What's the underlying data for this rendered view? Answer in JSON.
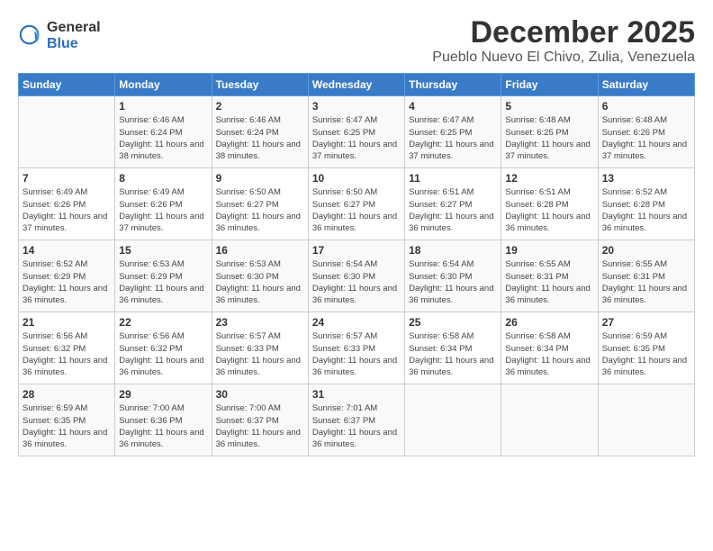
{
  "logo": {
    "general": "General",
    "blue": "Blue"
  },
  "title": "December 2025",
  "subtitle": "Pueblo Nuevo El Chivo, Zulia, Venezuela",
  "days_of_week": [
    "Sunday",
    "Monday",
    "Tuesday",
    "Wednesday",
    "Thursday",
    "Friday",
    "Saturday"
  ],
  "weeks": [
    [
      {
        "day": "",
        "sunrise": "",
        "sunset": "",
        "daylight": ""
      },
      {
        "day": "1",
        "sunrise": "Sunrise: 6:46 AM",
        "sunset": "Sunset: 6:24 PM",
        "daylight": "Daylight: 11 hours and 38 minutes."
      },
      {
        "day": "2",
        "sunrise": "Sunrise: 6:46 AM",
        "sunset": "Sunset: 6:24 PM",
        "daylight": "Daylight: 11 hours and 38 minutes."
      },
      {
        "day": "3",
        "sunrise": "Sunrise: 6:47 AM",
        "sunset": "Sunset: 6:25 PM",
        "daylight": "Daylight: 11 hours and 37 minutes."
      },
      {
        "day": "4",
        "sunrise": "Sunrise: 6:47 AM",
        "sunset": "Sunset: 6:25 PM",
        "daylight": "Daylight: 11 hours and 37 minutes."
      },
      {
        "day": "5",
        "sunrise": "Sunrise: 6:48 AM",
        "sunset": "Sunset: 6:25 PM",
        "daylight": "Daylight: 11 hours and 37 minutes."
      },
      {
        "day": "6",
        "sunrise": "Sunrise: 6:48 AM",
        "sunset": "Sunset: 6:26 PM",
        "daylight": "Daylight: 11 hours and 37 minutes."
      }
    ],
    [
      {
        "day": "7",
        "sunrise": "Sunrise: 6:49 AM",
        "sunset": "Sunset: 6:26 PM",
        "daylight": "Daylight: 11 hours and 37 minutes."
      },
      {
        "day": "8",
        "sunrise": "Sunrise: 6:49 AM",
        "sunset": "Sunset: 6:26 PM",
        "daylight": "Daylight: 11 hours and 37 minutes."
      },
      {
        "day": "9",
        "sunrise": "Sunrise: 6:50 AM",
        "sunset": "Sunset: 6:27 PM",
        "daylight": "Daylight: 11 hours and 36 minutes."
      },
      {
        "day": "10",
        "sunrise": "Sunrise: 6:50 AM",
        "sunset": "Sunset: 6:27 PM",
        "daylight": "Daylight: 11 hours and 36 minutes."
      },
      {
        "day": "11",
        "sunrise": "Sunrise: 6:51 AM",
        "sunset": "Sunset: 6:27 PM",
        "daylight": "Daylight: 11 hours and 36 minutes."
      },
      {
        "day": "12",
        "sunrise": "Sunrise: 6:51 AM",
        "sunset": "Sunset: 6:28 PM",
        "daylight": "Daylight: 11 hours and 36 minutes."
      },
      {
        "day": "13",
        "sunrise": "Sunrise: 6:52 AM",
        "sunset": "Sunset: 6:28 PM",
        "daylight": "Daylight: 11 hours and 36 minutes."
      }
    ],
    [
      {
        "day": "14",
        "sunrise": "Sunrise: 6:52 AM",
        "sunset": "Sunset: 6:29 PM",
        "daylight": "Daylight: 11 hours and 36 minutes."
      },
      {
        "day": "15",
        "sunrise": "Sunrise: 6:53 AM",
        "sunset": "Sunset: 6:29 PM",
        "daylight": "Daylight: 11 hours and 36 minutes."
      },
      {
        "day": "16",
        "sunrise": "Sunrise: 6:53 AM",
        "sunset": "Sunset: 6:30 PM",
        "daylight": "Daylight: 11 hours and 36 minutes."
      },
      {
        "day": "17",
        "sunrise": "Sunrise: 6:54 AM",
        "sunset": "Sunset: 6:30 PM",
        "daylight": "Daylight: 11 hours and 36 minutes."
      },
      {
        "day": "18",
        "sunrise": "Sunrise: 6:54 AM",
        "sunset": "Sunset: 6:30 PM",
        "daylight": "Daylight: 11 hours and 36 minutes."
      },
      {
        "day": "19",
        "sunrise": "Sunrise: 6:55 AM",
        "sunset": "Sunset: 6:31 PM",
        "daylight": "Daylight: 11 hours and 36 minutes."
      },
      {
        "day": "20",
        "sunrise": "Sunrise: 6:55 AM",
        "sunset": "Sunset: 6:31 PM",
        "daylight": "Daylight: 11 hours and 36 minutes."
      }
    ],
    [
      {
        "day": "21",
        "sunrise": "Sunrise: 6:56 AM",
        "sunset": "Sunset: 6:32 PM",
        "daylight": "Daylight: 11 hours and 36 minutes."
      },
      {
        "day": "22",
        "sunrise": "Sunrise: 6:56 AM",
        "sunset": "Sunset: 6:32 PM",
        "daylight": "Daylight: 11 hours and 36 minutes."
      },
      {
        "day": "23",
        "sunrise": "Sunrise: 6:57 AM",
        "sunset": "Sunset: 6:33 PM",
        "daylight": "Daylight: 11 hours and 36 minutes."
      },
      {
        "day": "24",
        "sunrise": "Sunrise: 6:57 AM",
        "sunset": "Sunset: 6:33 PM",
        "daylight": "Daylight: 11 hours and 36 minutes."
      },
      {
        "day": "25",
        "sunrise": "Sunrise: 6:58 AM",
        "sunset": "Sunset: 6:34 PM",
        "daylight": "Daylight: 11 hours and 36 minutes."
      },
      {
        "day": "26",
        "sunrise": "Sunrise: 6:58 AM",
        "sunset": "Sunset: 6:34 PM",
        "daylight": "Daylight: 11 hours and 36 minutes."
      },
      {
        "day": "27",
        "sunrise": "Sunrise: 6:59 AM",
        "sunset": "Sunset: 6:35 PM",
        "daylight": "Daylight: 11 hours and 36 minutes."
      }
    ],
    [
      {
        "day": "28",
        "sunrise": "Sunrise: 6:59 AM",
        "sunset": "Sunset: 6:35 PM",
        "daylight": "Daylight: 11 hours and 36 minutes."
      },
      {
        "day": "29",
        "sunrise": "Sunrise: 7:00 AM",
        "sunset": "Sunset: 6:36 PM",
        "daylight": "Daylight: 11 hours and 36 minutes."
      },
      {
        "day": "30",
        "sunrise": "Sunrise: 7:00 AM",
        "sunset": "Sunset: 6:37 PM",
        "daylight": "Daylight: 11 hours and 36 minutes."
      },
      {
        "day": "31",
        "sunrise": "Sunrise: 7:01 AM",
        "sunset": "Sunset: 6:37 PM",
        "daylight": "Daylight: 11 hours and 36 minutes."
      },
      {
        "day": "",
        "sunrise": "",
        "sunset": "",
        "daylight": ""
      },
      {
        "day": "",
        "sunrise": "",
        "sunset": "",
        "daylight": ""
      },
      {
        "day": "",
        "sunrise": "",
        "sunset": "",
        "daylight": ""
      }
    ]
  ]
}
